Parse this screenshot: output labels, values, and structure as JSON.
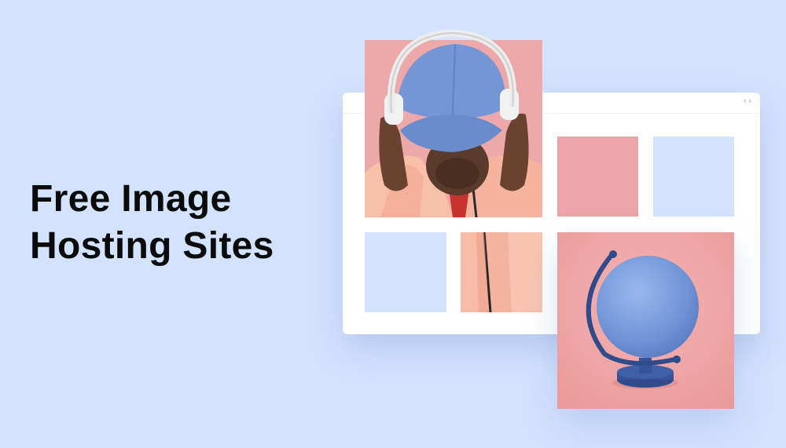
{
  "headline": {
    "line1": "Free Image",
    "line2": "Hosting Sites"
  },
  "browser_window": {
    "icon": "code-brackets-icon",
    "icon_glyph": "‹›"
  },
  "colors": {
    "background": "#d3e2fd",
    "tile_pink": "#eba5a8",
    "tile_blue": "#d3e2fd",
    "cap_blue": "#6f8fd0",
    "jacket_peach": "#f6b7a4"
  },
  "images": {
    "person": "person-with-headphones-and-cap",
    "globe": "blue-desk-globe"
  }
}
